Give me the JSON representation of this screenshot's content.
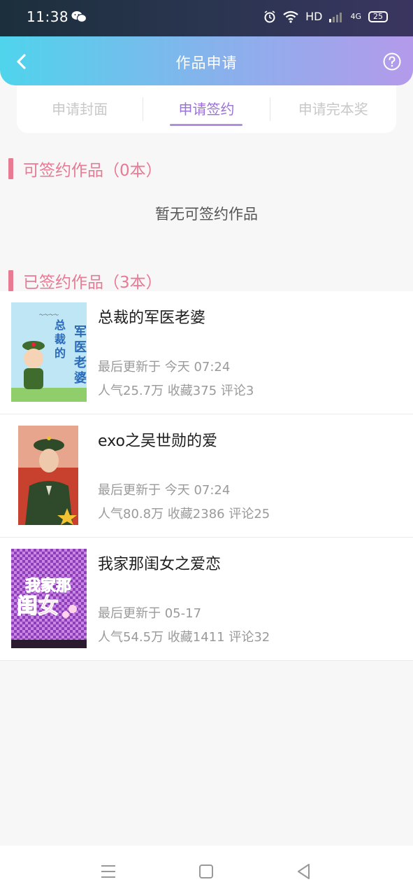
{
  "status_bar": {
    "time": "11:38",
    "network": "HD",
    "signal": "4G",
    "battery": "25",
    "icons": [
      "wechat-icon",
      "alarm-icon",
      "wifi-icon",
      "signal-icon",
      "battery-icon"
    ]
  },
  "header": {
    "title": "作品申请",
    "icons": [
      "back-icon",
      "help-icon"
    ]
  },
  "tabs": [
    {
      "label": "申请封面",
      "active": false
    },
    {
      "label": "申请签约",
      "active": true
    },
    {
      "label": "申请完本奖",
      "active": false
    }
  ],
  "sections": {
    "signable": {
      "title": "可签约作品（0本）",
      "empty": "暂无可签约作品"
    },
    "signed": {
      "title": "已签约作品（3本）"
    }
  },
  "works": [
    {
      "title": "总裁的军医老婆",
      "updated": "最后更新于 今天 07:24",
      "stats": "人气25.7万 收藏375 评论3"
    },
    {
      "title": "exo之吴世勋的爱",
      "updated": "最后更新于 今天 07:24",
      "stats": "人气80.8万 收藏2386 评论25"
    },
    {
      "title": "我家那闺女之爱恋",
      "updated": "最后更新于 05-17",
      "stats": "人气54.5万 收藏1411 评论32"
    }
  ],
  "colors": {
    "accent": "#9a72d8",
    "section": "#e87a94",
    "header_start": "#4fd4ec",
    "header_end": "#b49aea"
  },
  "navbar": {
    "icons": [
      "menu-icon",
      "home-icon",
      "back-triangle-icon"
    ]
  }
}
